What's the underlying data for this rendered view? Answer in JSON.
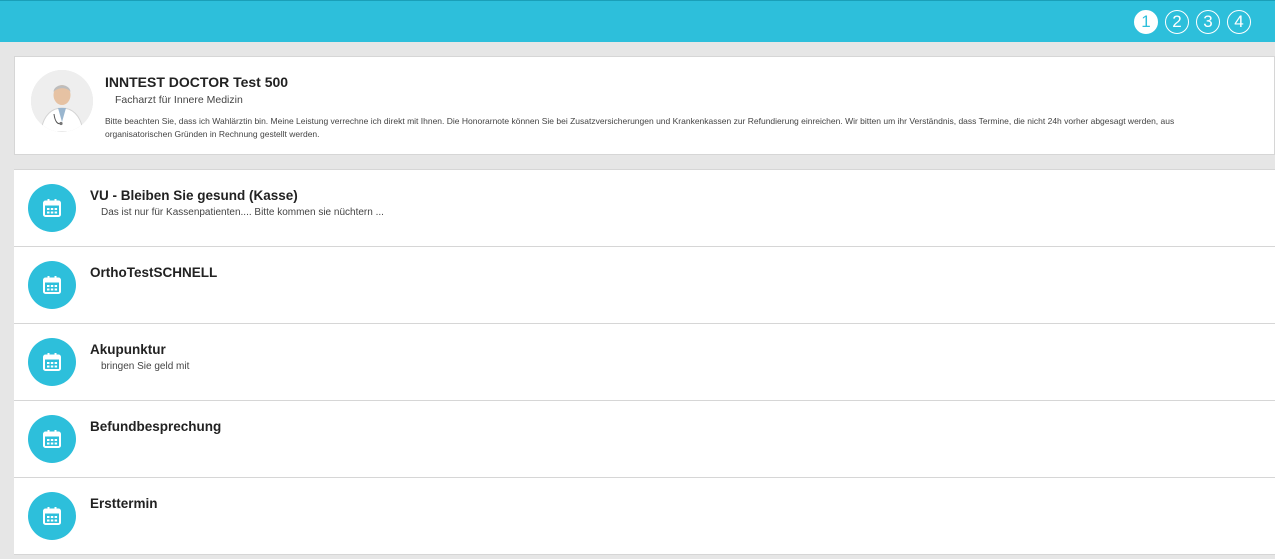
{
  "steps": [
    {
      "label": "1",
      "active": true
    },
    {
      "label": "2",
      "active": false
    },
    {
      "label": "3",
      "active": false
    },
    {
      "label": "4",
      "active": false
    }
  ],
  "doctor": {
    "name": "INNTEST DOCTOR Test 500",
    "specialty": "Facharzt für Innere Medizin",
    "note": "Bitte beachten Sie, dass ich Wahlärztin bin. Meine Leistung verrechne ich direkt mit Ihnen. Die Honorarnote können Sie bei Zusatzversicherungen und Krankenkassen zur Refundierung einreichen. Wir bitten um ihr Verständnis, dass Termine, die nicht 24h vorher abgesagt werden, aus organisatorischen Gründen in Rechnung gestellt werden."
  },
  "services": [
    {
      "title": "VU - Bleiben Sie gesund (Kasse)",
      "description": "Das ist nur für Kassenpatienten.... Bitte kommen sie nüchtern ...",
      "icon": "calendar-icon"
    },
    {
      "title": "OrthoTestSCHNELL",
      "description": "",
      "icon": "calendar-icon"
    },
    {
      "title": "Akupunktur",
      "description": "bringen Sie geld mit",
      "icon": "calendar-icon"
    },
    {
      "title": "Befundbesprechung",
      "description": "",
      "icon": "calendar-icon"
    },
    {
      "title": "Ersttermin",
      "description": "",
      "icon": "calendar-icon"
    }
  ],
  "colors": {
    "accent": "#2dbfdb",
    "background": "#e6e6e6",
    "card": "#ffffff"
  }
}
